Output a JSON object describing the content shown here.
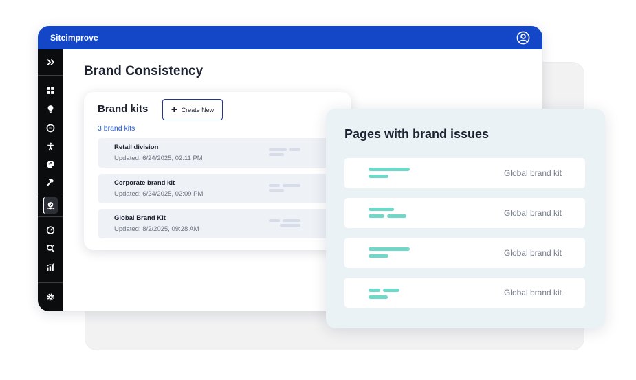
{
  "app": {
    "title": "Siteimprove"
  },
  "sidebar": {
    "items": [
      {
        "icon": "expand-chevrons-icon"
      },
      {
        "icon": "dashboard-grid-icon"
      },
      {
        "icon": "lightbulb-icon"
      },
      {
        "icon": "quality-assurance-icon"
      },
      {
        "icon": "accessibility-icon"
      },
      {
        "icon": "brand-palette-icon"
      },
      {
        "icon": "hammer-icon"
      },
      {
        "icon": "brand-consistency-icon",
        "active": true
      },
      {
        "icon": "performance-gauge-icon"
      },
      {
        "icon": "seo-icon"
      },
      {
        "icon": "analytics-icon"
      },
      {
        "icon": "settings-gear-icon"
      }
    ]
  },
  "page": {
    "title": "Brand Consistency"
  },
  "brand_kits": {
    "title": "Brand kits",
    "create_label": "Create New",
    "count_label": "3 brand kits",
    "items": [
      {
        "name": "Retail division",
        "updated": "Updated: 6/24/2025, 02:11 PM"
      },
      {
        "name": "Corporate brand kit",
        "updated": "Updated: 6/24/2025, 02:09 PM"
      },
      {
        "name": "Global Brand Kit",
        "updated": "Updated: 8/2/2025, 09:28 AM"
      }
    ]
  },
  "issues": {
    "title": "Pages with brand issues",
    "rows": [
      {
        "label": "Global brand kit"
      },
      {
        "label": "Global brand kit"
      },
      {
        "label": "Global brand kit"
      },
      {
        "label": "Global brand kit"
      }
    ]
  },
  "colors": {
    "topbar": "#1446c8",
    "sidebar": "#0b0c0e",
    "link": "#1f5ad6",
    "accent_teal": "#6fd8c9",
    "issues_panel": "#eaf2f6"
  }
}
